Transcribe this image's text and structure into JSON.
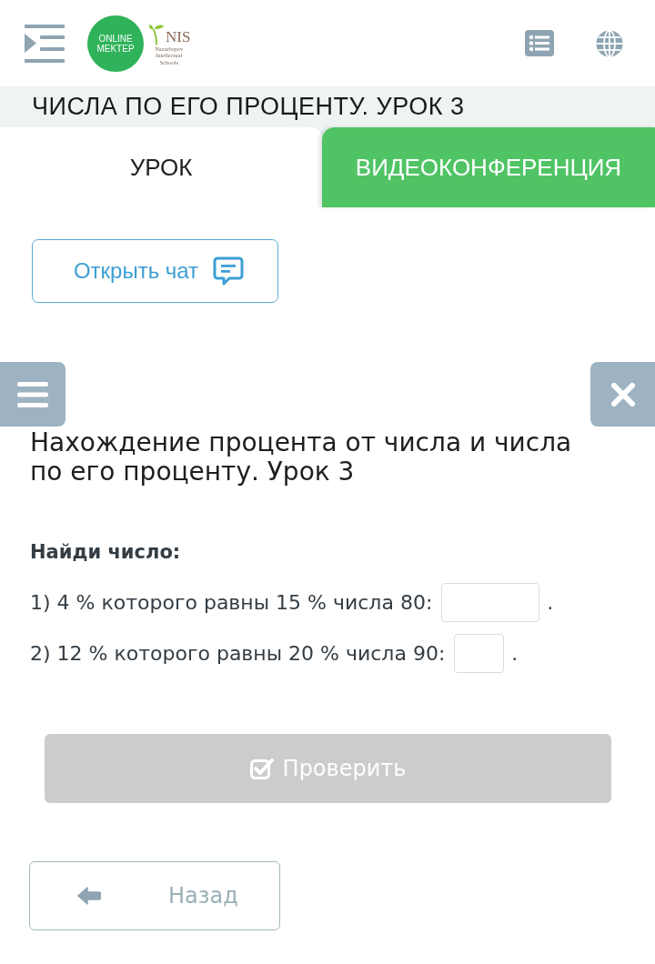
{
  "header": {
    "logo": {
      "line_1": "ONLINE",
      "line_2": "MEKTEP"
    },
    "partner_logo": {
      "name": "NIS",
      "subtitle": "Nazarbayev Intellectual Schools"
    }
  },
  "page_title": "ЧИСЛА ПО ЕГО ПРОЦЕНТУ. УРОК 3",
  "tabs": [
    {
      "label": "УРОК",
      "selected": true
    },
    {
      "label": "ВИДЕОКОНФЕРЕНЦИЯ",
      "selected": false
    }
  ],
  "chat_button": {
    "label": "Открыть чат"
  },
  "lesson": {
    "title": "Нахождение процента от числа и числа по его проценту. Урок 3",
    "task": {
      "prompt": "Найди число:",
      "items": [
        {
          "text": "1) 4 % которого равны 15 % числа 80:",
          "suffix": "."
        },
        {
          "text": "2) 12 % которого равны 20 % числа 90:",
          "suffix": "."
        }
      ]
    }
  },
  "check_button": {
    "label": "Проверить",
    "disabled": true
  },
  "back_button": {
    "label": "Назад"
  }
}
